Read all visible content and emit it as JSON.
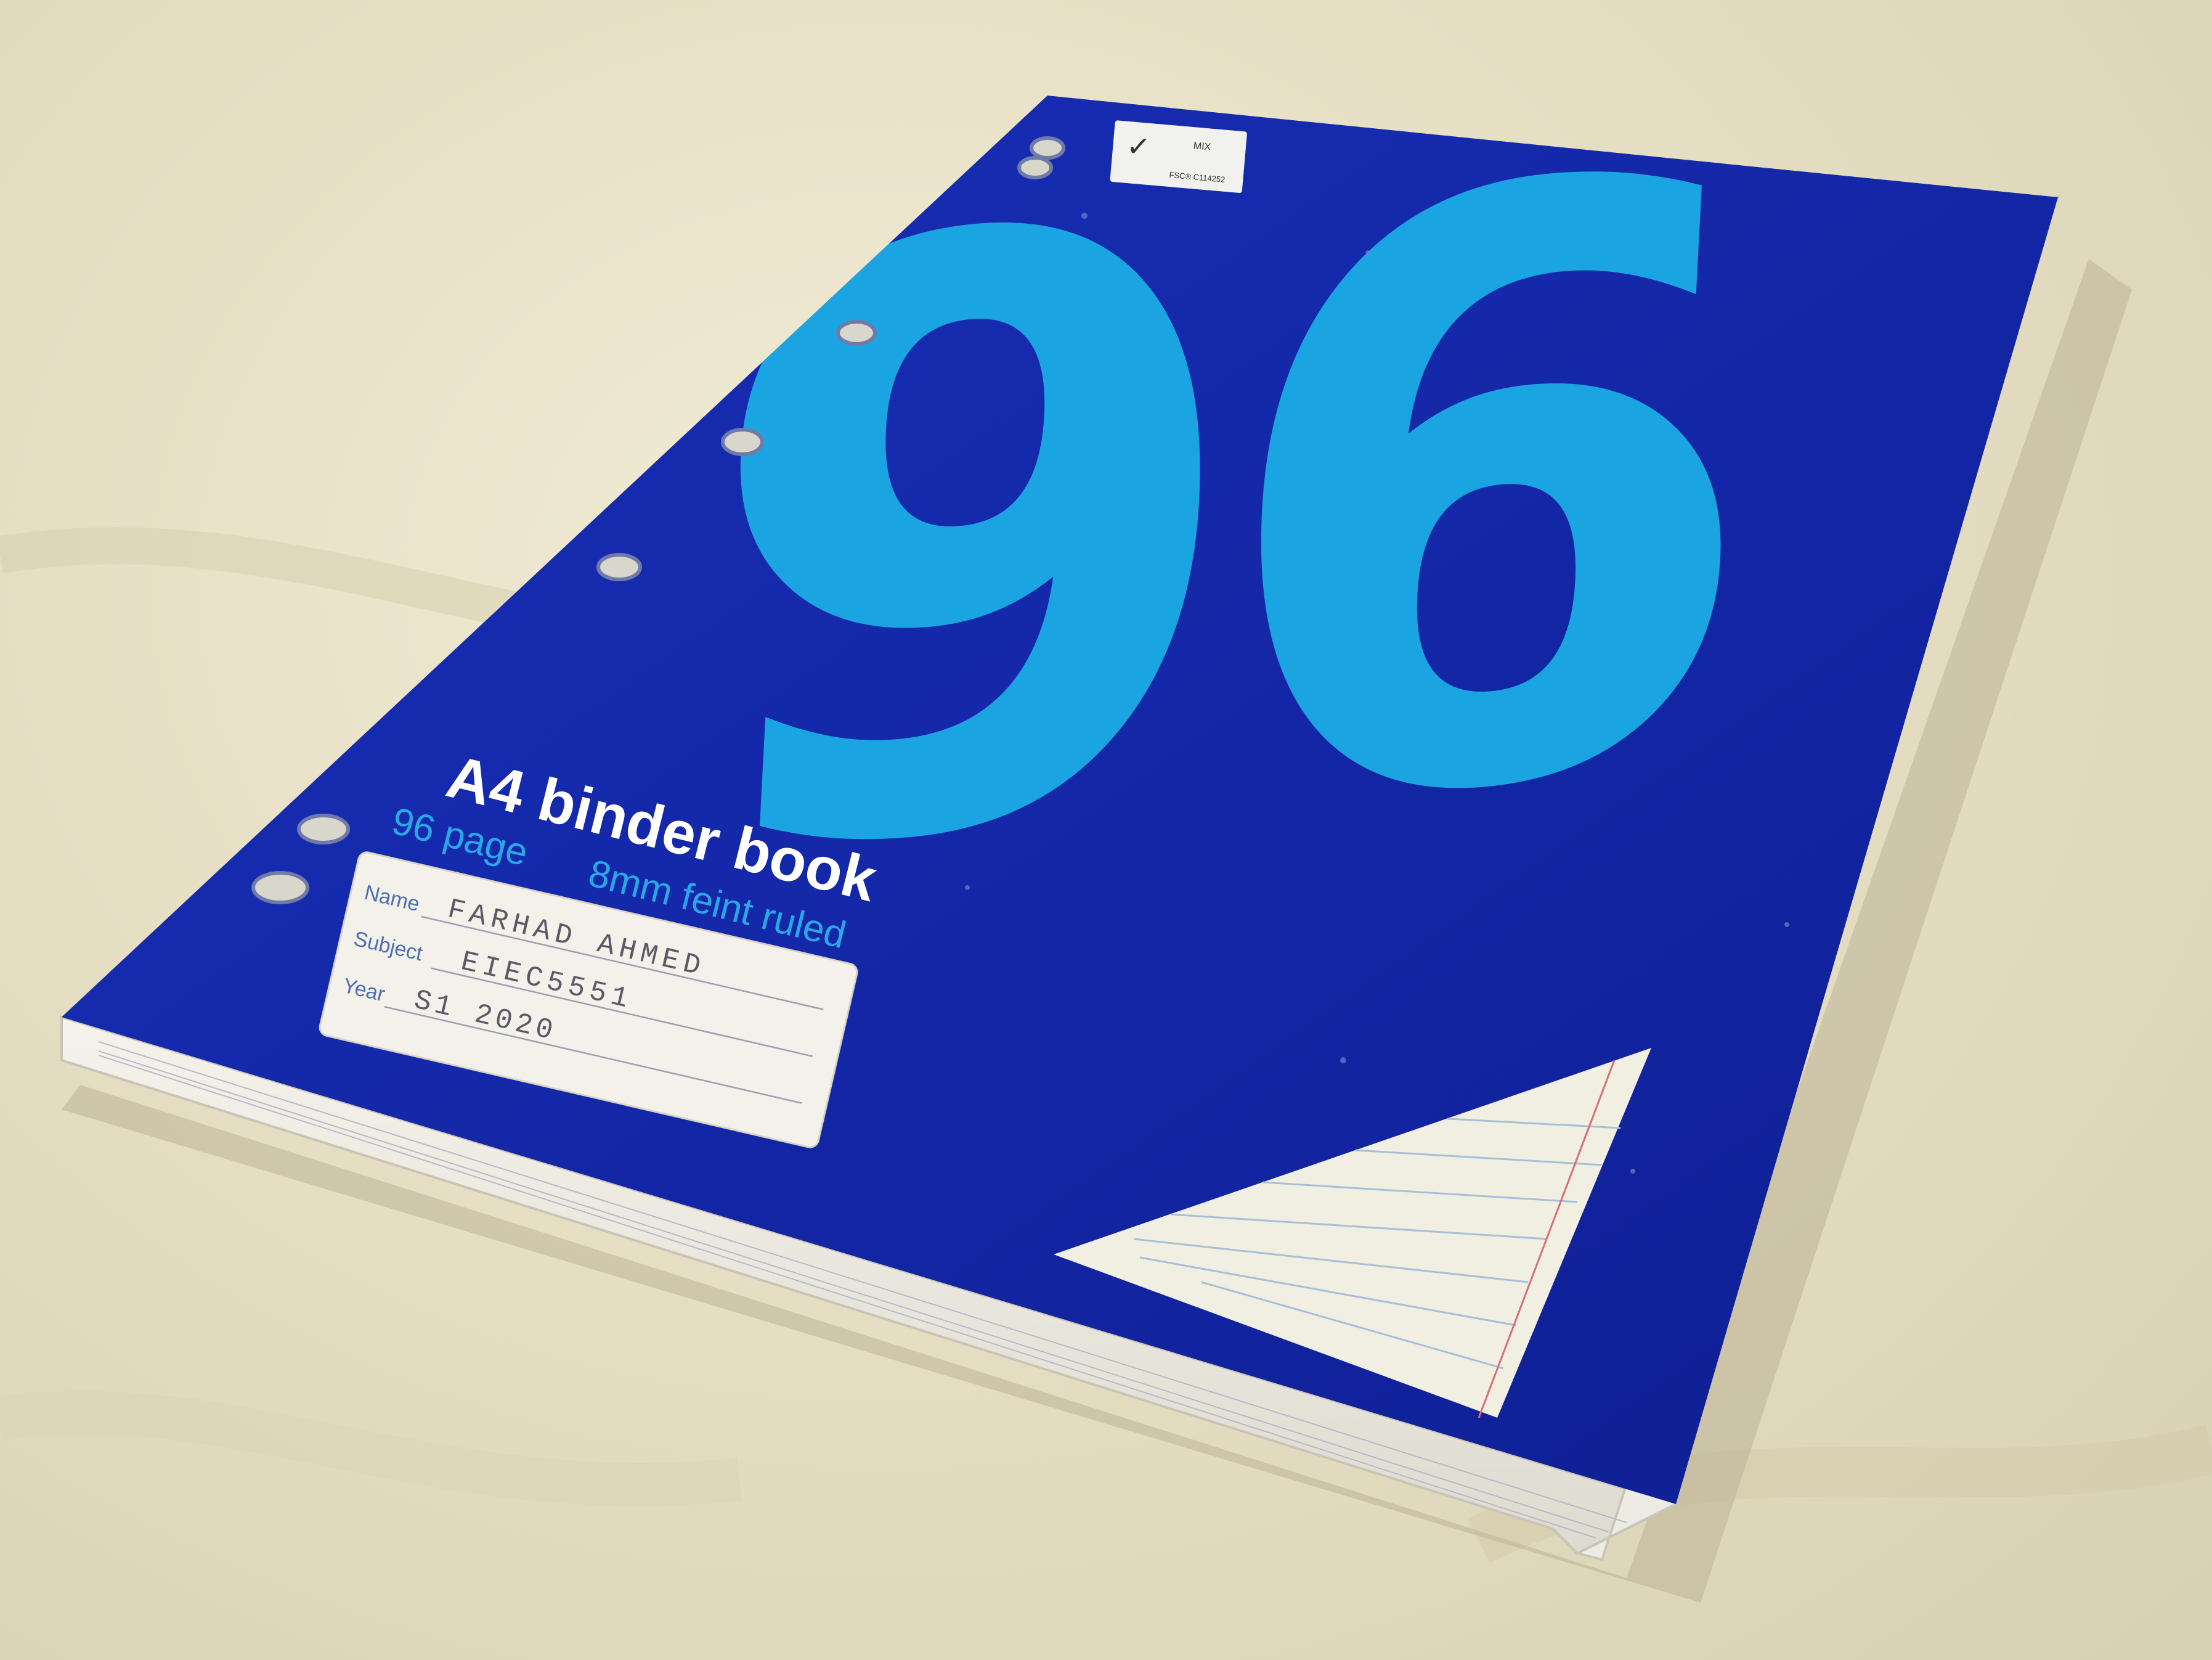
{
  "cover": {
    "big_number": "96",
    "title": "A4 binder book",
    "subtitle_pages": "96 page",
    "subtitle_ruling": "8mm feint ruled",
    "fsc_label": "MIX",
    "fsc_code": "FSC® C114252"
  },
  "label": {
    "name_field": "Name",
    "subject_field": "Subject",
    "year_field": "Year",
    "name_value": "FARHAD AHMED",
    "subject_value": "EIEC5551",
    "year_value": "S1 2020"
  },
  "colors": {
    "cover_blue": "#1226a6",
    "accent_cyan": "#19a3e0",
    "background": "#e9e2c8"
  }
}
